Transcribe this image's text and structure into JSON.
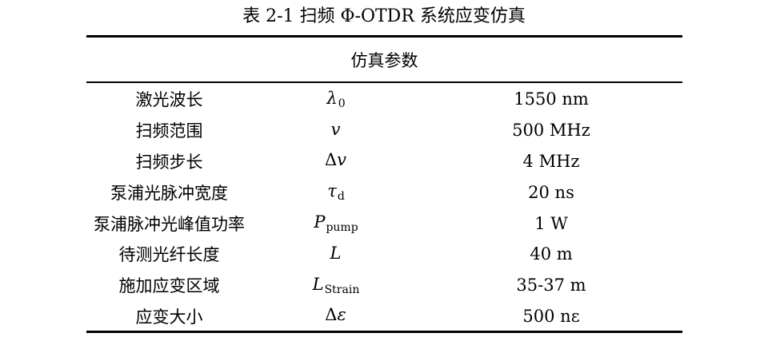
{
  "caption": "表 2-1  扫频 Φ-OTDR 系统应变仿真",
  "header": "仿真参数",
  "rows": [
    {
      "name": "激光波长",
      "prefix": "",
      "symbol": "λ",
      "sub": "0",
      "value": "1550 nm"
    },
    {
      "name": "扫频范围",
      "prefix": "",
      "symbol": "v",
      "sub": "",
      "value": "500 MHz"
    },
    {
      "name": "扫频步长",
      "prefix": "Δ",
      "symbol": "v",
      "sub": "",
      "value": "4 MHz"
    },
    {
      "name": "泵浦光脉冲宽度",
      "prefix": "",
      "symbol": "τ",
      "sub": "d",
      "value": "20 ns"
    },
    {
      "name": "泵浦脉冲光峰值功率",
      "prefix": "",
      "symbol": "P",
      "sub": "pump",
      "value": "1 W"
    },
    {
      "name": "待测光纤长度",
      "prefix": "",
      "symbol": "L",
      "sub": "",
      "value": "40 m"
    },
    {
      "name": "施加应变区域",
      "prefix": "",
      "symbol": "L",
      "sub": "Strain",
      "value": "35-37 m"
    },
    {
      "name": "应变大小",
      "prefix": "Δ",
      "symbol": "ε",
      "sub": "",
      "value": "500 nε"
    }
  ]
}
